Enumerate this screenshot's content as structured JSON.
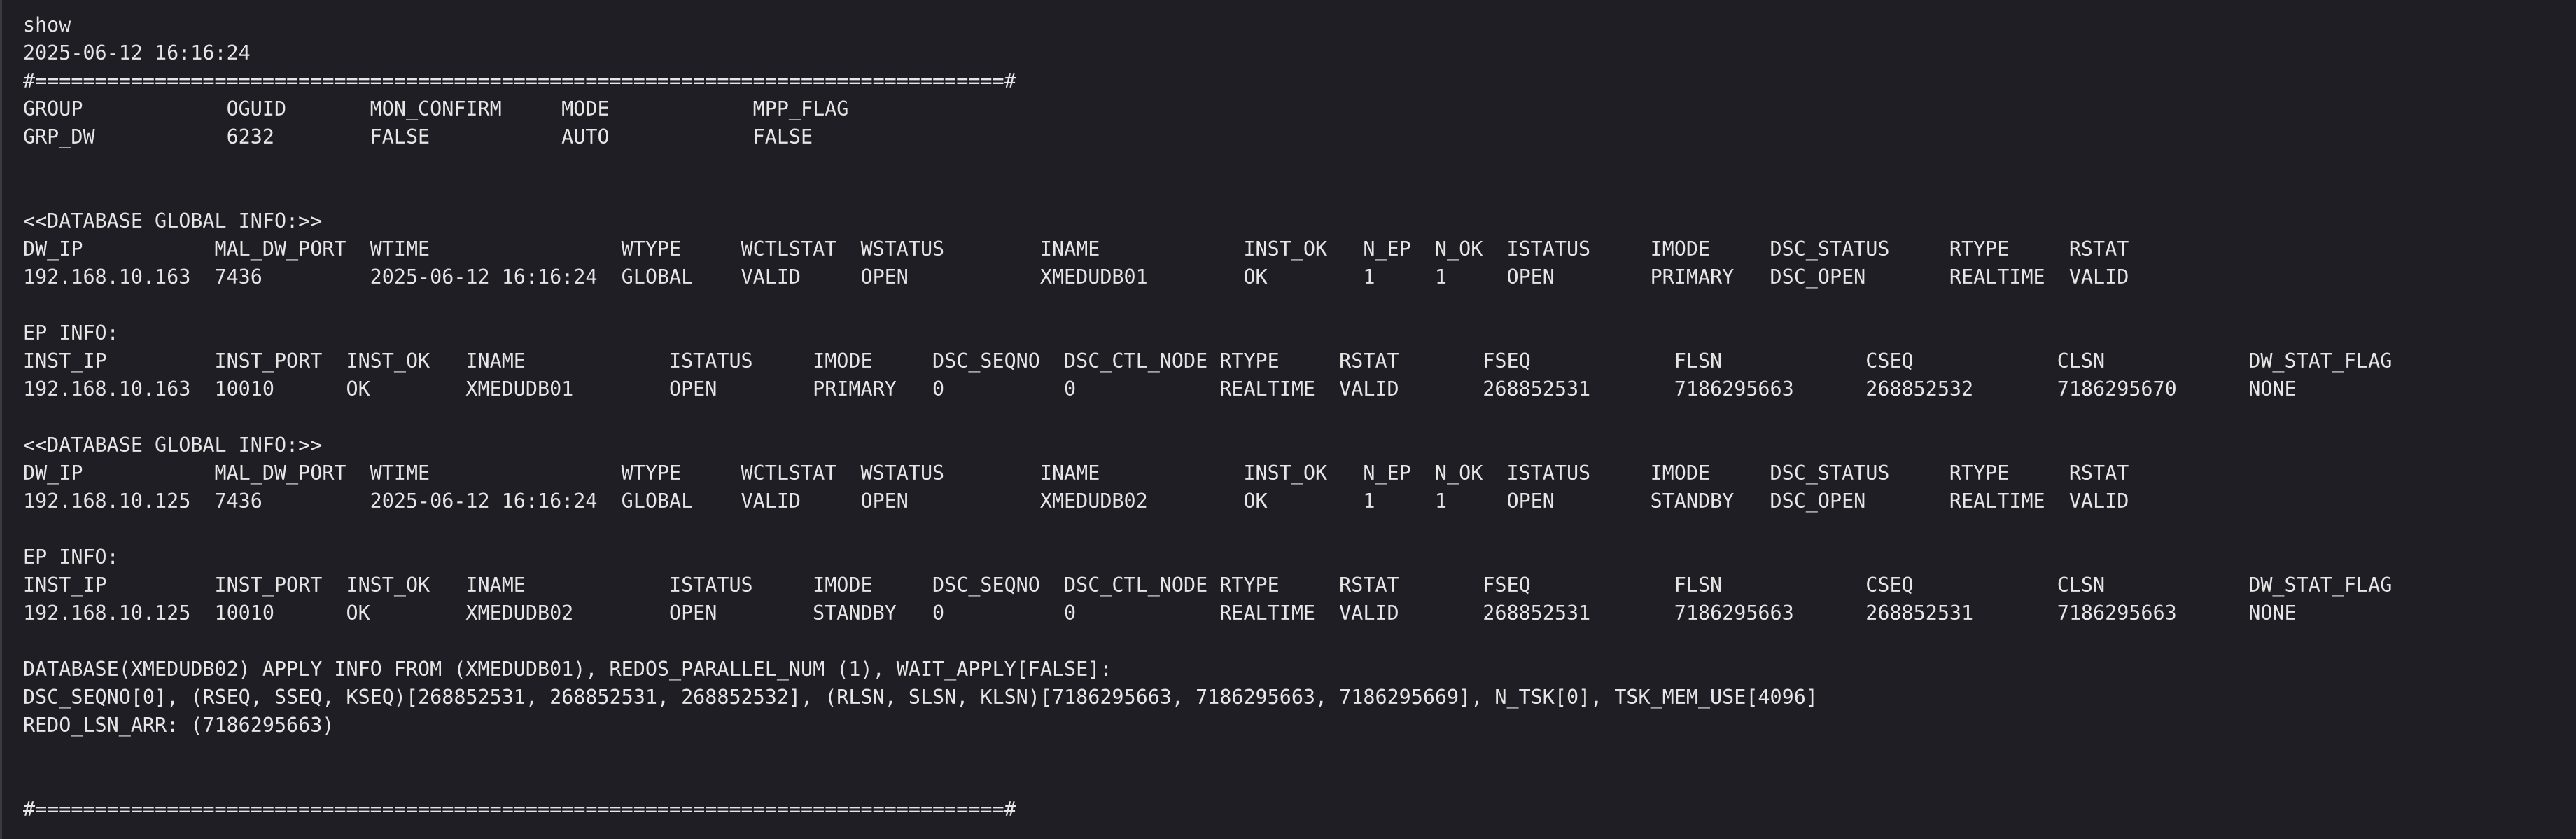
{
  "terminal": {
    "lines": [
      "show",
      "2025-06-12 16:16:24",
      "#=================================================================================#",
      "GROUP            OGUID       MON_CONFIRM     MODE            MPP_FLAG",
      "GRP_DW           6232        FALSE           AUTO            FALSE",
      "",
      "",
      "<<DATABASE GLOBAL INFO:>>",
      "DW_IP           MAL_DW_PORT  WTIME                WTYPE     WCTLSTAT  WSTATUS        INAME            INST_OK   N_EP  N_OK  ISTATUS     IMODE     DSC_STATUS     RTYPE     RSTAT",
      "192.168.10.163  7436         2025-06-12 16:16:24  GLOBAL    VALID     OPEN           XMEDUDB01        OK        1     1     OPEN        PRIMARY   DSC_OPEN       REALTIME  VALID",
      "",
      "EP INFO:",
      "INST_IP         INST_PORT  INST_OK   INAME            ISTATUS     IMODE     DSC_SEQNO  DSC_CTL_NODE RTYPE     RSTAT       FSEQ            FLSN            CSEQ            CLSN            DW_STAT_FLAG",
      "192.168.10.163  10010      OK        XMEDUDB01        OPEN        PRIMARY   0          0            REALTIME  VALID       268852531       7186295663      268852532       7186295670      NONE",
      "",
      "<<DATABASE GLOBAL INFO:>>",
      "DW_IP           MAL_DW_PORT  WTIME                WTYPE     WCTLSTAT  WSTATUS        INAME            INST_OK   N_EP  N_OK  ISTATUS     IMODE     DSC_STATUS     RTYPE     RSTAT",
      "192.168.10.125  7436         2025-06-12 16:16:24  GLOBAL    VALID     OPEN           XMEDUDB02        OK        1     1     OPEN        STANDBY   DSC_OPEN       REALTIME  VALID",
      "",
      "EP INFO:",
      "INST_IP         INST_PORT  INST_OK   INAME            ISTATUS     IMODE     DSC_SEQNO  DSC_CTL_NODE RTYPE     RSTAT       FSEQ            FLSN            CSEQ            CLSN            DW_STAT_FLAG",
      "192.168.10.125  10010      OK        XMEDUDB02        OPEN        STANDBY   0          0            REALTIME  VALID       268852531       7186295663      268852531       7186295663      NONE",
      "",
      "DATABASE(XMEDUDB02) APPLY INFO FROM (XMEDUDB01), REDOS_PARALLEL_NUM (1), WAIT_APPLY[FALSE]:",
      "DSC_SEQNO[0], (RSEQ, SSEQ, KSEQ)[268852531, 268852531, 268852532], (RLSN, SLSN, KLSN)[7186295663, 7186295663, 7186295669], N_TSK[0], TSK_MEM_USE[4096]",
      "REDO_LSN_ARR: (7186295663)",
      "",
      "",
      "#=================================================================================#"
    ]
  }
}
